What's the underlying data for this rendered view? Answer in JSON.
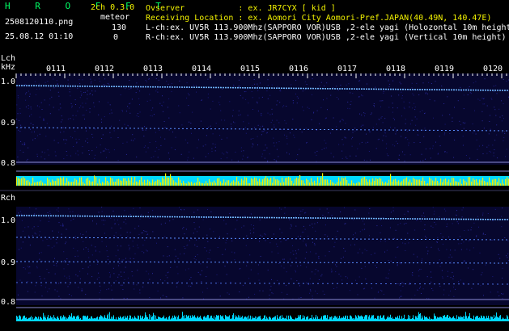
{
  "header": {
    "brand": "H R O F F T",
    "channel_label": "2ch 0.3.0",
    "filename": "2508120110.png",
    "datetime": "25.08.12 01:10",
    "meteor_label": "meteor",
    "meteor_count_1": "130",
    "meteor_count_2": "0",
    "observer_line": "Ovserver           : ex. JR7CYX [ kid ]",
    "location_line": "Receiving Location : ex. Aomori City Aomori-Pref.JAPAN(40.49N, 140.47E)",
    "lch_line": "L-ch:ex. UV5R 113.900Mhz(SAPPORO VOR)USB ,2-ele yagi (Holozontal 10m height)",
    "rch_line": "R-ch:ex. UV5R 113.900Mhz(SAPPORO VOR)USB ,2-ele yagi (Vertical 10m height)"
  },
  "lch": {
    "label": "Lch",
    "unit": "kHz",
    "yticks": [
      "1.0",
      "0.9",
      "0.8"
    ]
  },
  "rch": {
    "label": "Rch",
    "yticks": [
      "1.0",
      "0.9",
      "0.8"
    ]
  },
  "time_labels": [
    "0111",
    "0112",
    "0113",
    "0114",
    "0115",
    "0116",
    "0117",
    "0118",
    "0119",
    "0120"
  ],
  "colors": {
    "background": "#000000",
    "spectrogram_bg": "#0a0a3a",
    "signal_line": "#5fa8ff",
    "meteor_bar": "#f2f200",
    "level_bar": "#00e5ff",
    "brand": "#00ff66"
  }
}
